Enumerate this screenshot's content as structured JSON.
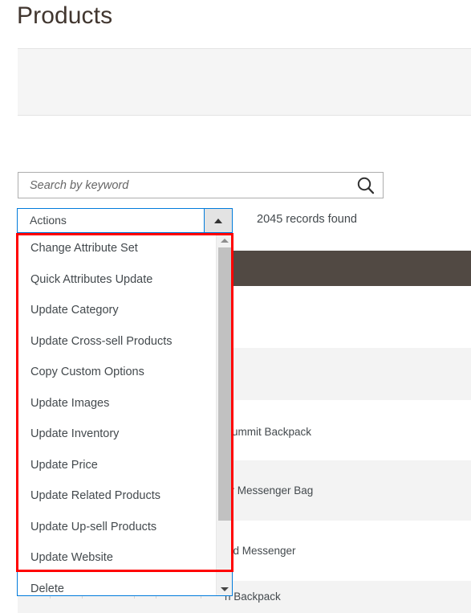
{
  "page": {
    "title": "Products"
  },
  "filter_panel": {
    "content": ""
  },
  "search": {
    "placeholder": "Search by keyword",
    "value": "",
    "icon": "search-icon"
  },
  "actions_control": {
    "label": "Actions",
    "arrow_icon": "caret-up-icon",
    "expanded": true,
    "border_color": "#007bdb"
  },
  "records": {
    "text": "2045 records found",
    "count": 2045
  },
  "actions_options": {
    "items": [
      {
        "label": "Change Attribute Set"
      },
      {
        "label": "Quick Attributes Update"
      },
      {
        "label": "Update Category"
      },
      {
        "label": "Update Cross-sell Products"
      },
      {
        "label": "Copy Custom Options"
      },
      {
        "label": "Update Images"
      },
      {
        "label": "Update Inventory"
      },
      {
        "label": "Update Price"
      },
      {
        "label": "Update Related Products"
      },
      {
        "label": "Update Up-sell Products"
      },
      {
        "label": "Update Website"
      },
      {
        "label": "Delete"
      }
    ],
    "scrollbar": {
      "up_icon": "scroll-up-arrow-icon",
      "down_icon": "scroll-down-arrow-icon",
      "thumb": "scrollbar-thumb"
    }
  },
  "grid": {
    "header_color": "#514943",
    "rows": [
      {
        "name": ""
      },
      {
        "name": ""
      },
      {
        "name": " Summit Backpack"
      },
      {
        "name": "er Messenger Bag"
      },
      {
        "name": "eld Messenger"
      },
      {
        "name": "n Backpack"
      }
    ]
  },
  "annotation": {
    "highlight_color": "#ff0000"
  }
}
